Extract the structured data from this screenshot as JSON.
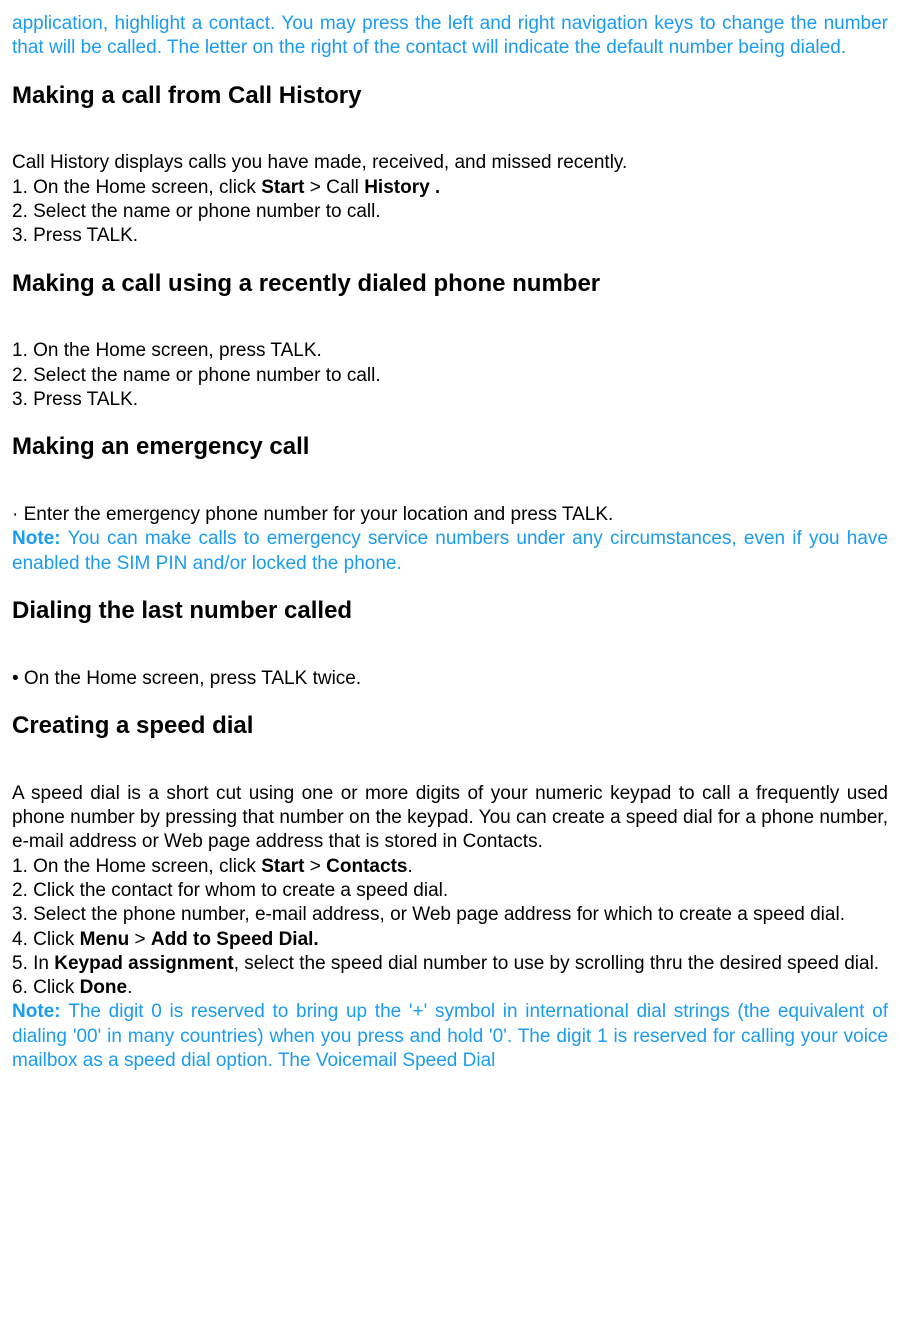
{
  "intro": {
    "blueLine1": "application, highlight a contact. You may press the left and right navigation keys to change the number that will be called. The letter on the right of the contact will indicate the default number being dialed."
  },
  "section1": {
    "heading": "Making a call from Call History",
    "line1": "Call History displays calls you have made, received, and missed recently.",
    "line2a": "1. On the Home screen, click ",
    "line2b": "Start",
    "line2c": " > Call ",
    "line2d": "History .",
    "line3": "2. Select the name or phone number to call.",
    "line4": "3. Press TALK."
  },
  "section2": {
    "heading": "Making a call using a recently dialed phone number",
    "line1": "1. On the Home screen, press TALK.",
    "line2": "2. Select the name or phone number to call.",
    "line3": "3. Press TALK."
  },
  "section3": {
    "heading": "Making an emergency call",
    "line1": "· Enter the emergency phone number for your location and press TALK.",
    "noteLabel": "Note: ",
    "noteText": "You can make calls to emergency service numbers under any circumstances, even if you have enabled the SIM PIN and/or locked the phone."
  },
  "section4": {
    "heading": "Dialing the last number called",
    "line1": "• On the Home screen, press TALK twice."
  },
  "section5": {
    "heading": "Creating a speed dial",
    "intro": "A speed dial is a short cut using one or more digits of your numeric keypad to call a frequently used phone number by pressing that number on the keypad. You can create a speed dial for a phone number, e-mail address or Web page address that is stored in Contacts.",
    "step1a": "1. On the Home screen, click ",
    "step1b": "Start",
    "step1c": " > ",
    "step1d": "Contacts",
    "step1e": ".",
    "step2": "2. Click the contact for whom to create a speed dial.",
    "step3": "3. Select the phone number, e-mail address, or Web page address for which to create a speed dial.",
    "step4a": "4. Click ",
    "step4b": "Menu",
    "step4c": " > ",
    "step4d": "Add to Speed Dial.",
    "step5a": "5. In ",
    "step5b": "Keypad assignment",
    "step5c": ", select the speed dial number to use by scrolling thru the desired speed dial.",
    "step6a": "6. Click ",
    "step6b": "Done",
    "step6c": ".",
    "noteLabel": "Note: ",
    "noteText": "The digit 0 is reserved to bring up the '+' symbol in international dial strings (the equivalent of dialing '00' in many countries) when you press and hold '0'. The digit 1 is reserved for calling your voice mailbox as a speed dial option. The Voicemail Speed Dial"
  }
}
